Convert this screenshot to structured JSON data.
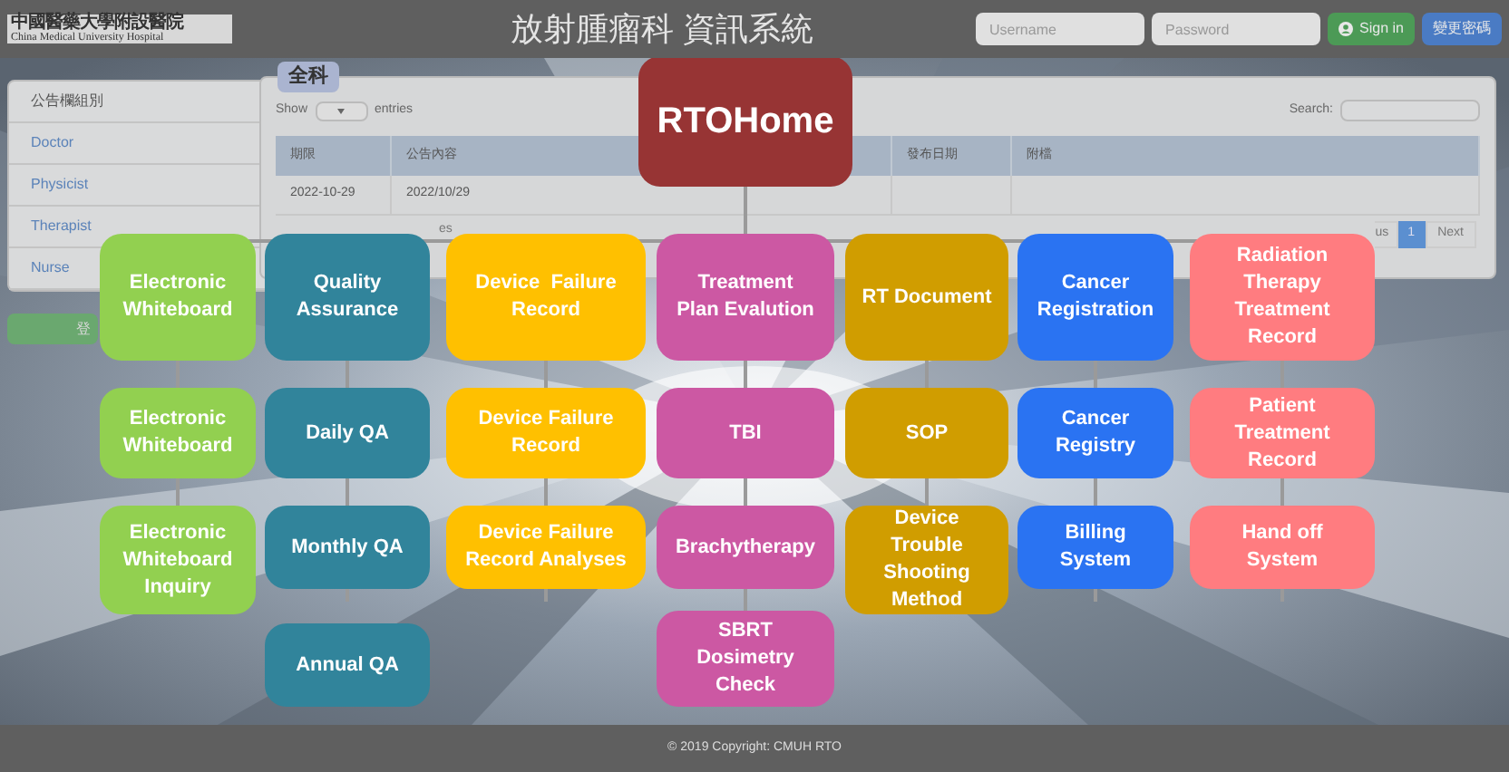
{
  "header": {
    "logo_line1": "中國醫藥大學附設醫院",
    "logo_line2": "China Medical University Hospital",
    "title": "放射腫瘤科 資訊系統",
    "username": {
      "placeholder": "Username"
    },
    "password": {
      "placeholder": "Password"
    },
    "sign_in": "Sign in",
    "change_password": "變更密碼"
  },
  "sidebar": {
    "heading": "公告欄組別",
    "items": [
      "Doctor",
      "Physicist",
      "Therapist",
      "Nurse"
    ],
    "button": "登"
  },
  "panel": {
    "tag": "全科",
    "show": "Show",
    "entries": "entries",
    "search_label": "Search:",
    "columns": [
      "期限",
      "公告內容",
      "發布日期",
      "附檔"
    ],
    "rows": [
      [
        "2022-10-29",
        "2022/10/29",
        "",
        ""
      ]
    ],
    "info": "es",
    "pagination": {
      "previous": "us",
      "pages": [
        {
          "label": "1",
          "selected": true
        }
      ],
      "next": "Next"
    }
  },
  "diagram": {
    "root": "RTOHome",
    "branches": [
      {
        "color": "#92d050",
        "nodes": [
          "Electronic\nWhiteboard",
          "Electronic\nWhiteboard",
          "Electronic\nWhiteboard\nInquiry"
        ]
      },
      {
        "color": "#31849b",
        "nodes": [
          "Quality\nAssurance",
          "Daily QA",
          "Monthly QA",
          "Annual QA"
        ]
      },
      {
        "color": "#ffc000",
        "nodes": [
          "Device  Failure\nRecord",
          "Device Failure\nRecord",
          "Device Failure\nRecord Analyses"
        ]
      },
      {
        "color": "#cc58a3",
        "nodes": [
          "Treatment\nPlan Evalution",
          "TBI",
          "Brachytherapy",
          "SBRT\nDosimetry\nCheck"
        ]
      },
      {
        "color": "#d09d00",
        "nodes": [
          "RT Document",
          "SOP",
          "Device\nTrouble\nShooting\nMethod"
        ]
      },
      {
        "color": "#2a73f2",
        "nodes": [
          "Cancer\nRegistration",
          "Cancer\nRegistry",
          "Billing\nSystem"
        ]
      },
      {
        "color": "#ff7c80",
        "nodes": [
          "Radiation\nTherapy\nTreatment\nRecord",
          "Patient\nTreatment\nRecord",
          "Hand off\nSystem"
        ]
      }
    ]
  },
  "footer": "© 2019 Copyright: CMUH RTO"
}
